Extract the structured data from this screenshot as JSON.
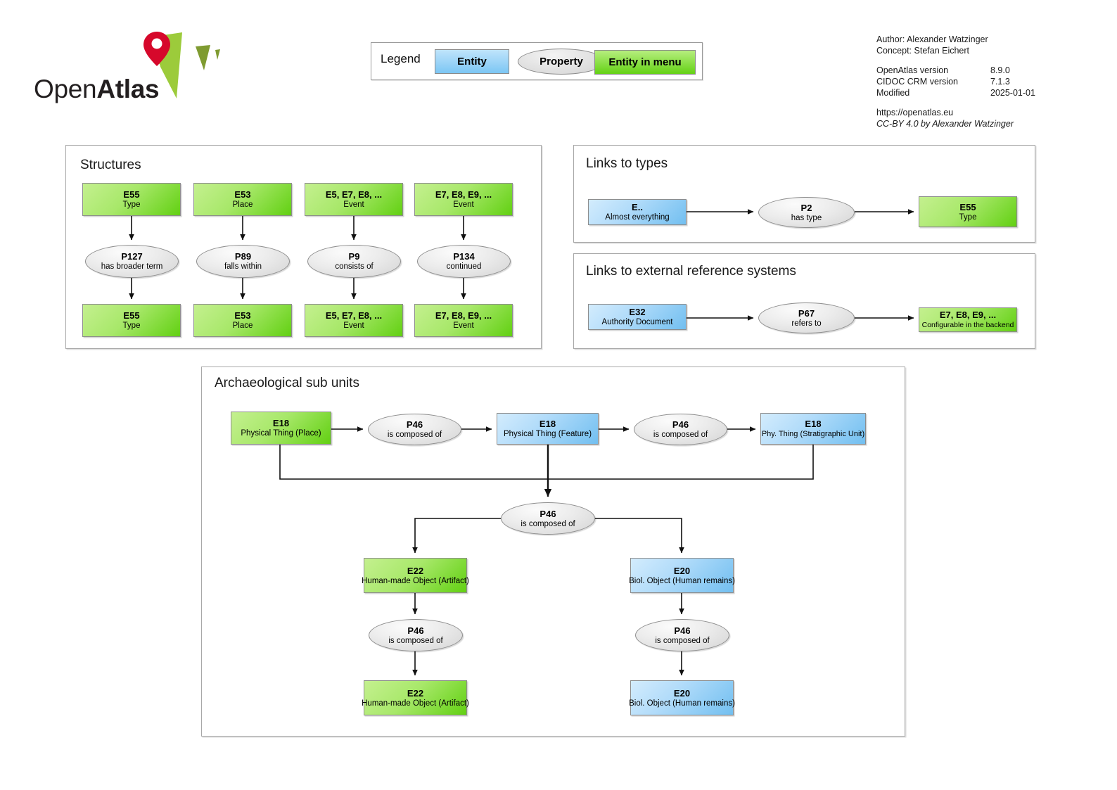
{
  "logo": {
    "text_light": "Open",
    "text_bold": "Atlas",
    "pin_color": "#d6082b",
    "leaf_color": "#9ccb3b",
    "leaf_dark_color": "#7f9b31"
  },
  "meta": {
    "author_line": "Author: Alexander Watzinger",
    "concept_line": "Concept: Stefan Eichert",
    "rows": [
      {
        "label": "OpenAtlas version",
        "value": "8.9.0"
      },
      {
        "label": "CIDOC CRM version",
        "value": "7.1.3"
      },
      {
        "label": "Modified",
        "value": "2025-01-01"
      }
    ],
    "url": "https://openatlas.eu",
    "license": "CC-BY 4.0 by Alexander Watzinger"
  },
  "legend": {
    "title": "Legend",
    "entity": "Entity",
    "property": "Property",
    "entity_in_menu": "Entity in menu"
  },
  "colors": {
    "entity_blue": "#8fd0f5",
    "entity_menu_green": "#8ee33f",
    "property_grey": "#e2e2e2",
    "panel_border": "#a8a8a8"
  },
  "panels": {
    "structures": {
      "title": "Structures",
      "columns": [
        {
          "top": {
            "code": "E55",
            "label": "Type",
            "kind": "green"
          },
          "middle": {
            "code": "P127",
            "label": "has broader term"
          },
          "bottom": {
            "code": "E55",
            "label": "Type",
            "kind": "green"
          }
        },
        {
          "top": {
            "code": "E53",
            "label": "Place",
            "kind": "green"
          },
          "middle": {
            "code": "P89",
            "label": "falls within"
          },
          "bottom": {
            "code": "E53",
            "label": "Place",
            "kind": "green"
          }
        },
        {
          "top": {
            "code": "E5, E7, E8, ...",
            "label": "Event",
            "kind": "green"
          },
          "middle": {
            "code": "P9",
            "label": "consists of"
          },
          "bottom": {
            "code": "E5, E7, E8, ...",
            "label": "Event",
            "kind": "green"
          }
        },
        {
          "top": {
            "code": "E7, E8, E9, ...",
            "label": "Event",
            "kind": "green"
          },
          "middle": {
            "code": "P134",
            "label": "continued"
          },
          "bottom": {
            "code": "E7, E8, E9, ...",
            "label": "Event",
            "kind": "green"
          }
        }
      ]
    },
    "links_to_types": {
      "title": "Links to types",
      "source": {
        "code": "E..",
        "label": "Almost everything",
        "kind": "blue"
      },
      "property": {
        "code": "P2",
        "label": "has type"
      },
      "target": {
        "code": "E55",
        "label": "Type",
        "kind": "green"
      }
    },
    "links_to_ext": {
      "title": "Links to external reference systems",
      "source": {
        "code": "E32",
        "label": "Authority Document",
        "kind": "blue"
      },
      "property": {
        "code": "P67",
        "label": "refers to"
      },
      "target": {
        "code": "E7, E8, E9, ...",
        "label": "Configurable in the backend",
        "kind": "green"
      }
    },
    "archaeological": {
      "title": "Archaeological sub units",
      "row_top": {
        "place": {
          "code": "E18",
          "label": "Physical Thing (Place)",
          "kind": "green"
        },
        "prop1": {
          "code": "P46",
          "label": "is composed of"
        },
        "feature": {
          "code": "E18",
          "label": "Physical Thing (Feature)",
          "kind": "blue"
        },
        "prop2": {
          "code": "P46",
          "label": "is composed of"
        },
        "stratunit": {
          "code": "E18",
          "label": "Phy. Thing (Stratigraphic Unit)",
          "kind": "blue"
        }
      },
      "hub": {
        "code": "P46",
        "label": "is composed of"
      },
      "left_branch": {
        "object": {
          "code": "E22",
          "label": "Human-made Object (Artifact)",
          "kind": "green"
        },
        "prop": {
          "code": "P46",
          "label": "is composed of"
        },
        "child": {
          "code": "E22",
          "label": "Human-made Object (Artifact)",
          "kind": "green"
        }
      },
      "right_branch": {
        "object": {
          "code": "E20",
          "label": "Biol. Object (Human remains)",
          "kind": "blue"
        },
        "prop": {
          "code": "P46",
          "label": "is composed of"
        },
        "child": {
          "code": "E20",
          "label": "Biol. Object (Human remains)",
          "kind": "blue"
        }
      }
    }
  }
}
